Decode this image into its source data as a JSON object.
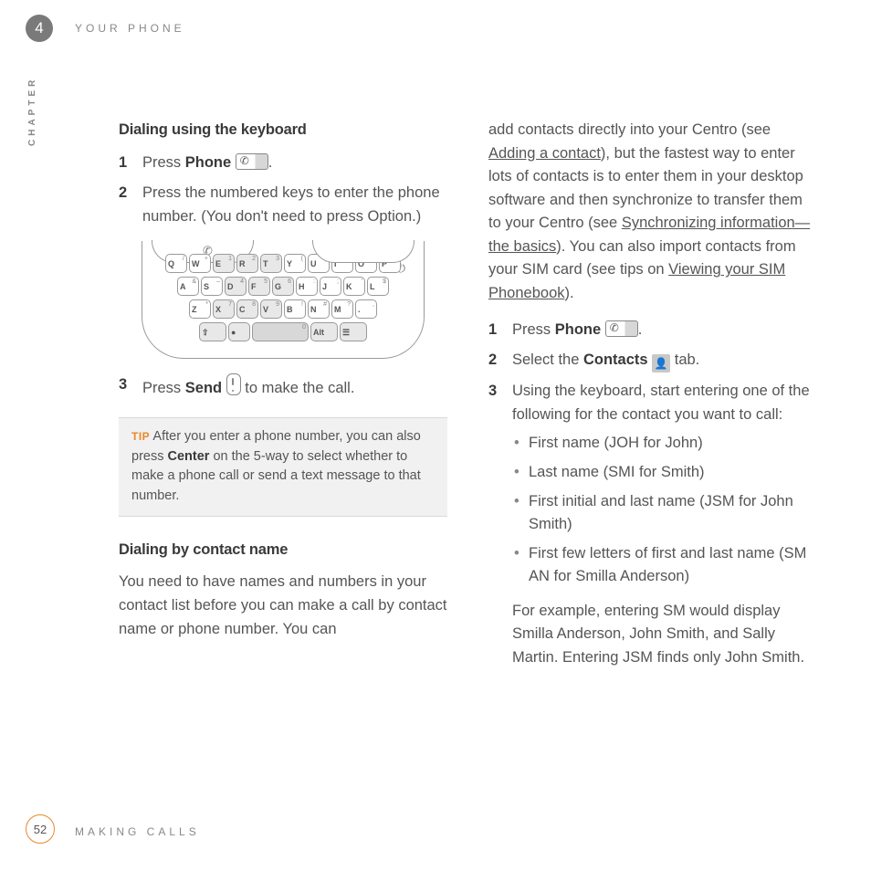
{
  "page": {
    "chapter_number": "4",
    "top_section": "YOUR PHONE",
    "chapter_label": "CHAPTER",
    "page_number": "52",
    "bottom_section": "MAKING CALLS"
  },
  "left": {
    "h_keyboard": "Dialing using the keyboard",
    "step1_pre": "Press ",
    "step1_bold": "Phone",
    "step1_post": ".",
    "step2": "Press the numbered keys to enter the phone number. (You don't need to press Option.)",
    "step3_pre": "Press ",
    "step3_bold": "Send",
    "step3_post": " to make the call.",
    "tip_label": "TIP",
    "tip_text_pre": " After you enter a phone number, you can also press ",
    "tip_bold": "Center",
    "tip_text_post": " on the 5-way to select whether to make a phone call or send a text message to that number.",
    "h_contact": "Dialing by contact name",
    "contact_intro": "You need to have names and numbers in your contact list before you can make a call by contact name or phone number. You can"
  },
  "right": {
    "intro_1": "add contacts directly into your Centro (see ",
    "link_add": "Adding a contact",
    "intro_2": "), but the fastest way to enter lots of contacts is to enter them in your desktop software and then synchronize to transfer them to your Centro (see ",
    "link_sync": "Synchronizing information—the basics",
    "intro_3": "). You can also import contacts from your SIM card (see tips on ",
    "link_sim": "Viewing your SIM Phonebook",
    "intro_4": ").",
    "step1_pre": "Press ",
    "step1_bold": "Phone",
    "step1_post": ".",
    "step2_pre": "Select the ",
    "step2_bold": "Contacts",
    "step2_post": " tab.",
    "step3": "Using the keyboard, start entering one of the following for the contact you want to call:",
    "bullets": [
      "First name (JOH for John)",
      "Last name (SMI for Smith)",
      "First initial and last name (JSM for John Smith)",
      "First few letters of first and last name (SM AN for Smilla Anderson)"
    ],
    "example": "For example, entering SM would display Smilla Anderson, John Smith, and Sally Martin. Entering JSM finds only John Smith."
  },
  "keyboard": {
    "row1": [
      {
        "l": "Q",
        "s": "/"
      },
      {
        "l": "W",
        "s": "+"
      },
      {
        "l": "E",
        "s": "1",
        "g": true
      },
      {
        "l": "R",
        "s": "2",
        "g": true
      },
      {
        "l": "T",
        "s": "3",
        "g": true
      },
      {
        "l": "Y",
        "s": "("
      },
      {
        "l": "U",
        "s": ")"
      },
      {
        "l": "I",
        "s": "@"
      },
      {
        "l": "O",
        "s": "\""
      },
      {
        "l": "P",
        "s": "✳"
      }
    ],
    "row2": [
      {
        "l": "A",
        "s": "&"
      },
      {
        "l": "S",
        "s": "–"
      },
      {
        "l": "D",
        "s": "4",
        "g": true
      },
      {
        "l": "F",
        "s": "5",
        "g": true
      },
      {
        "l": "G",
        "s": "6",
        "g": true
      },
      {
        "l": "H",
        "s": ":"
      },
      {
        "l": "J",
        "s": ";"
      },
      {
        "l": "K",
        "s": "'"
      },
      {
        "l": "L",
        "s": "$"
      }
    ],
    "row3": [
      {
        "l": "Z",
        "s": "*"
      },
      {
        "l": "X",
        "s": "7",
        "g": true
      },
      {
        "l": "C",
        "s": "8",
        "g": true
      },
      {
        "l": "V",
        "s": "9",
        "g": true
      },
      {
        "l": "B",
        "s": "!"
      },
      {
        "l": "N",
        "s": "#"
      },
      {
        "l": "M",
        "s": "?"
      },
      {
        "l": ".",
        "s": ","
      }
    ],
    "row4_left": "⇧",
    "row4_zero": "0",
    "row4_alt": "Alt",
    "row4_menu": "☰"
  }
}
